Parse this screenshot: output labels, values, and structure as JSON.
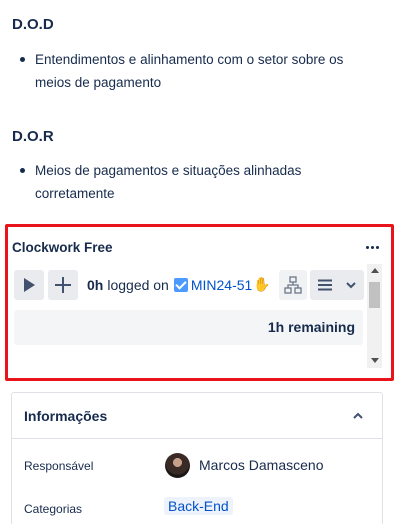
{
  "dod": {
    "title": "D.O.D",
    "bullets": [
      "Entendimentos e alinhamento com o setor sobre os meios de pagamento"
    ]
  },
  "dor": {
    "title": "D.O.R",
    "bullets": [
      "Meios de pagamentos e situações alinhadas corretamente"
    ]
  },
  "clockwork": {
    "title": "Clockwork Free",
    "logged_value": "0h",
    "logged_label": "logged on",
    "issue_key": "MIN24-51",
    "issue_emoji": "✋",
    "remaining": "1h remaining"
  },
  "info": {
    "title": "Informações",
    "assignee_label": "Responsável",
    "assignee_name": "Marcos Damasceno",
    "category_label": "Categorias",
    "category_value": "Back-End"
  },
  "colors": {
    "highlight": "#e8131b",
    "link": "#0052cc",
    "text": "#172b4d"
  }
}
